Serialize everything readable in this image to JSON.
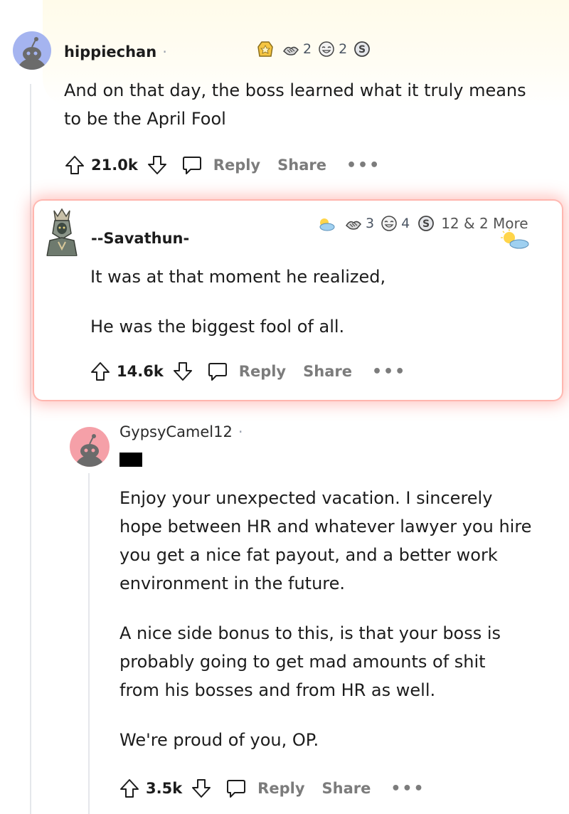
{
  "comments": [
    {
      "username": "hippiechan",
      "award_counts": [
        "2",
        "2"
      ],
      "body": [
        "And on that day, the boss learned what it truly means",
        "to be the April Fool"
      ],
      "score": "21.0k",
      "reply_label": "Reply",
      "share_label": "Share",
      "more_label": "•••"
    },
    {
      "username": "--Savathun-",
      "award_counts": [
        "3",
        "4",
        "12 & 2 More"
      ],
      "body": [
        "It was at that moment he realized,",
        "He was the biggest fool of all."
      ],
      "score": "14.6k",
      "reply_label": "Reply",
      "share_label": "Share",
      "more_label": "•••"
    },
    {
      "username": "GypsyCamel12",
      "body": [
        "Enjoy your unexpected vacation. I sincerely",
        "hope between HR and whatever lawyer you hire",
        "you get a nice fat payout, and a better work",
        "environment in the future.",
        "A nice side bonus to this, is that your boss is",
        "probably going to get mad amounts of shit",
        "from his bosses and from HR as well.",
        "We're proud of you, OP."
      ],
      "score": "3.5k",
      "reply_label": "Reply",
      "share_label": "Share",
      "more_label": "•••"
    }
  ],
  "colors": {
    "highlight_glow": "#ff786e",
    "avatar_blue": "#a5b4f0",
    "avatar_pink": "#f5a0a8",
    "muted": "#7c7c7c"
  }
}
